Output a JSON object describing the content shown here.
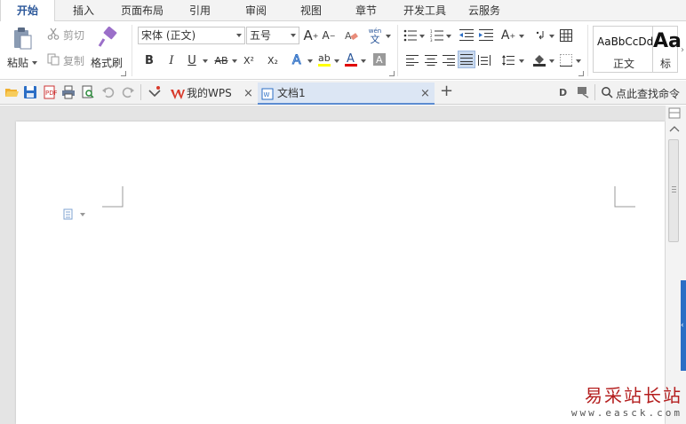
{
  "menu": {
    "tabs": [
      "开始",
      "插入",
      "页面布局",
      "引用",
      "审阅",
      "视图",
      "章节",
      "开发工具",
      "云服务"
    ],
    "active": "开始"
  },
  "ribbon": {
    "paste": "粘贴",
    "cut": "剪切",
    "copy": "复制",
    "format_painter": "格式刷",
    "font_name": "宋体 (正文)",
    "font_size": "五号",
    "bold": "B",
    "italic": "I",
    "underline": "U",
    "strike": "AB",
    "superscript": "X²",
    "subscript": "X₂",
    "font_color_letter": "A",
    "pinyin_top": "wén",
    "pinyin_bottom": "文",
    "styles": [
      {
        "preview": "AaBbCcDd",
        "name": "正文"
      },
      {
        "preview": "Aa",
        "name": "标"
      }
    ]
  },
  "qbar": {
    "doc_tabs": [
      {
        "label": "我的WPS",
        "active": false
      },
      {
        "label": "文档1",
        "active": true
      }
    ],
    "add_tab": "+",
    "search": "点此查找命令"
  },
  "watermark": {
    "cn": "易采站长站",
    "en": "www.easck.com"
  },
  "colors": {
    "accent": "#2b579a",
    "doc_tab_active": "#dce6f4",
    "wps_red": "#d83a2b",
    "highlight": "#ffff00",
    "font_color": "#e00000",
    "watermark_red": "#b41e1e"
  }
}
